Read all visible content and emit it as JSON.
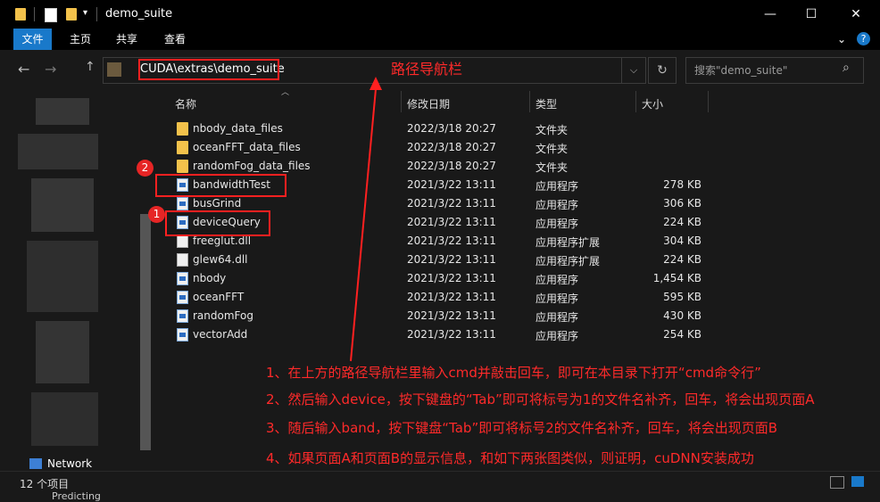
{
  "window": {
    "title": "demo_suite",
    "minimize": "—",
    "maximize": "☐",
    "close": "✕"
  },
  "ribbon": {
    "tabs": [
      "文件",
      "主页",
      "共享",
      "查看"
    ],
    "chevron": "⌄",
    "help": "?"
  },
  "nav": {
    "back": "←",
    "forward": "→",
    "up": "↑"
  },
  "address": {
    "path": "CUDA\\extras\\demo_suite",
    "dropdown": "⌵",
    "refresh": "↻"
  },
  "search": {
    "placeholder": "搜索\"demo_suite\"",
    "icon": "⌕"
  },
  "columns": {
    "name": "名称",
    "date": "修改日期",
    "type": "类型",
    "size": "大小"
  },
  "files": [
    {
      "name": "nbody_data_files",
      "date": "2022/3/18 20:27",
      "type": "文件夹",
      "size": "",
      "icon": "folder-icon"
    },
    {
      "name": "oceanFFT_data_files",
      "date": "2022/3/18 20:27",
      "type": "文件夹",
      "size": "",
      "icon": "folder-icon"
    },
    {
      "name": "randomFog_data_files",
      "date": "2022/3/18 20:27",
      "type": "文件夹",
      "size": "",
      "icon": "folder-icon"
    },
    {
      "name": "bandwidthTest",
      "date": "2021/3/22 13:11",
      "type": "应用程序",
      "size": "278 KB",
      "icon": "exe-icon"
    },
    {
      "name": "busGrind",
      "date": "2021/3/22 13:11",
      "type": "应用程序",
      "size": "306 KB",
      "icon": "exe-icon"
    },
    {
      "name": "deviceQuery",
      "date": "2021/3/22 13:11",
      "type": "应用程序",
      "size": "224 KB",
      "icon": "exe-icon"
    },
    {
      "name": "freeglut.dll",
      "date": "2021/3/22 13:11",
      "type": "应用程序扩展",
      "size": "304 KB",
      "icon": "dll-icon"
    },
    {
      "name": "glew64.dll",
      "date": "2021/3/22 13:11",
      "type": "应用程序扩展",
      "size": "224 KB",
      "icon": "dll-icon"
    },
    {
      "name": "nbody",
      "date": "2021/3/22 13:11",
      "type": "应用程序",
      "size": "1,454 KB",
      "icon": "exe-icon"
    },
    {
      "name": "oceanFFT",
      "date": "2021/3/22 13:11",
      "type": "应用程序",
      "size": "595 KB",
      "icon": "exe-icon"
    },
    {
      "name": "randomFog",
      "date": "2021/3/22 13:11",
      "type": "应用程序",
      "size": "430 KB",
      "icon": "exe-icon"
    },
    {
      "name": "vectorAdd",
      "date": "2021/3/22 13:11",
      "type": "应用程序",
      "size": "254 KB",
      "icon": "exe-icon"
    }
  ],
  "sidebar": {
    "network": "Network"
  },
  "status": {
    "count": "12 个项目",
    "predicting": "Predicting"
  },
  "annotations": {
    "address_label": "路径导航栏",
    "badge1": "1",
    "badge2": "2",
    "steps": [
      "1、在上方的路径导航栏里输入cmd并敲击回车，即可在本目录下打开“cmd命令行”",
      "2、然后输入device，按下键盘的“Tab”即可将标号为1的文件名补齐，回车，将会出现页面A",
      "3、随后输入band，按下键盘“Tab”即可将标号2的文件名补齐，回车，将会出现页面B",
      "4、如果页面A和页面B的显示信息，和如下两张图类似，则证明，cuDNN安装成功"
    ]
  },
  "colors": {
    "accent": "#1979ca",
    "annotation": "#ff2020",
    "folder": "#f3c24b"
  }
}
